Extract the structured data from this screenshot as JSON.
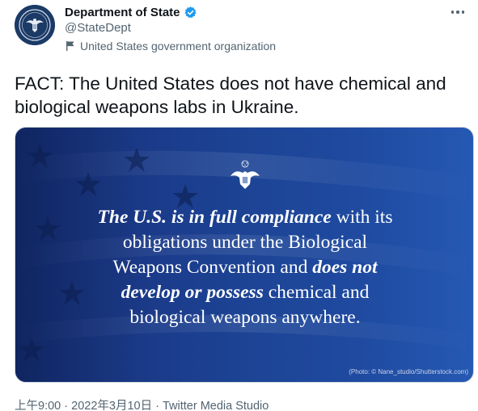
{
  "account": {
    "display_name": "Department of State",
    "handle": "@StateDept",
    "label": "United States government organization",
    "avatar_icon": "state-department-seal-icon",
    "verified_icon": "verified-badge-icon",
    "label_icon": "flag-icon"
  },
  "tweet": {
    "text": "FACT: The United States does not have chemical and biological weapons labs in Ukraine."
  },
  "media": {
    "quote": {
      "line1_emph": "The U.S. is in full compliance",
      "line1_rest": " with its",
      "line2": "obligations under the Biological",
      "line3_start": "Weapons Convention and ",
      "line3_emph": "does not",
      "line4_emph": "develop or possess",
      "line4_rest": " chemical and",
      "line5": "biological weapons anywhere."
    },
    "credit": "(Photo: © Nane_studio/Shutterstock.com)",
    "seal_icon": "eagle-seal-icon"
  },
  "footer": {
    "time": "上午9:00",
    "separator1": " · ",
    "date": "2022年3月10日",
    "separator2": " · ",
    "source": "Twitter Media Studio"
  },
  "colors": {
    "accent": "#1d9bf0",
    "muted": "#536471",
    "media_blue": "#1d4597"
  }
}
